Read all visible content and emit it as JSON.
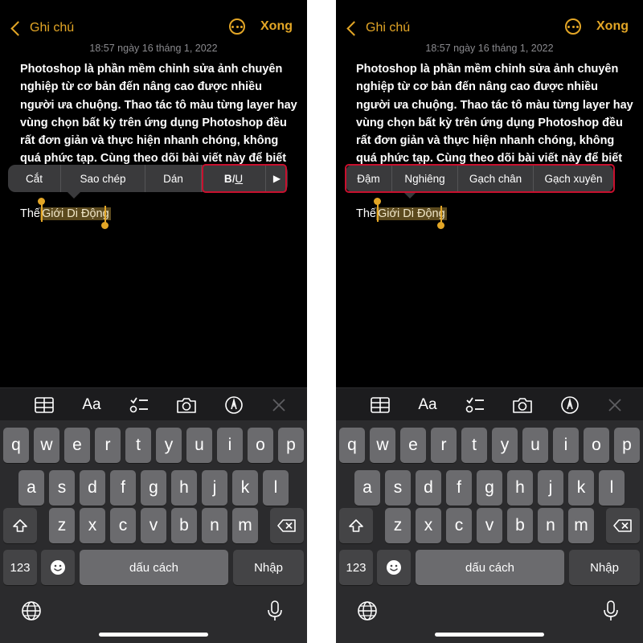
{
  "left": {
    "nav": {
      "back_label": "Ghi chú",
      "done_label": "Xong"
    },
    "timestamp": "18:57 ngày 16 tháng 1, 2022",
    "body_text": "Photoshop là phần mềm chỉnh sửa ảnh chuyên nghiệp từ cơ bản đến nâng cao được nhiều người ưa chuộng. Thao tác tô màu từng layer hay vùng chọn bất kỳ trên ứng dụng Photoshop đều rất đơn giản và thực hiện nhanh chóng, không quá phức tạp. Cùng theo dõi bài viết này để biết cách thao",
    "edit_menu": {
      "cut": "Cắt",
      "copy": "Sao chép",
      "paste": "Dán",
      "biu": "BIU",
      "more": "▶"
    },
    "selection": {
      "prefix": "Thế ",
      "selected": "Giới Di Động"
    }
  },
  "right": {
    "nav": {
      "back_label": "Ghi chú",
      "done_label": "Xong"
    },
    "timestamp": "18:57 ngày 16 tháng 1, 2022",
    "body_text": "Photoshop là phần mềm chỉnh sửa ảnh chuyên nghiệp từ cơ bản đến nâng cao được nhiều người ưa chuộng. Thao tác tô màu từng layer hay vùng chọn bất kỳ trên ứng dụng Photoshop đều rất đơn giản và thực hiện nhanh chóng, không quá phức tạp. Cùng theo dõi bài viết này để biết cách thao",
    "format_menu": {
      "bold": "Đậm",
      "italic": "Nghiêng",
      "underline": "Gạch chân",
      "strikethrough": "Gạch xuyên"
    },
    "selection": {
      "prefix": "Thế ",
      "selected": "Giới Di Động"
    }
  },
  "toolbar": {
    "aa": "Aa",
    "icons": [
      "table-icon",
      "text-format-icon",
      "checklist-icon",
      "camera-icon",
      "markup-pen-icon",
      "close-icon"
    ]
  },
  "keyboard": {
    "row1": [
      "q",
      "w",
      "e",
      "r",
      "t",
      "y",
      "u",
      "i",
      "o",
      "p"
    ],
    "row2": [
      "a",
      "s",
      "d",
      "f",
      "g",
      "h",
      "j",
      "k",
      "l"
    ],
    "row3": [
      "z",
      "x",
      "c",
      "v",
      "b",
      "n",
      "m"
    ],
    "numbers_label": "123",
    "space_label": "dấu cách",
    "return_label": "Nhập"
  },
  "colors": {
    "accent": "#e3a626",
    "highlight_border": "#c8102e",
    "menu_bg": "#3a3a3c",
    "key_bg": "#6b6b6e",
    "key_dark_bg": "#444446",
    "keyboard_bg": "#2b2b2d"
  }
}
